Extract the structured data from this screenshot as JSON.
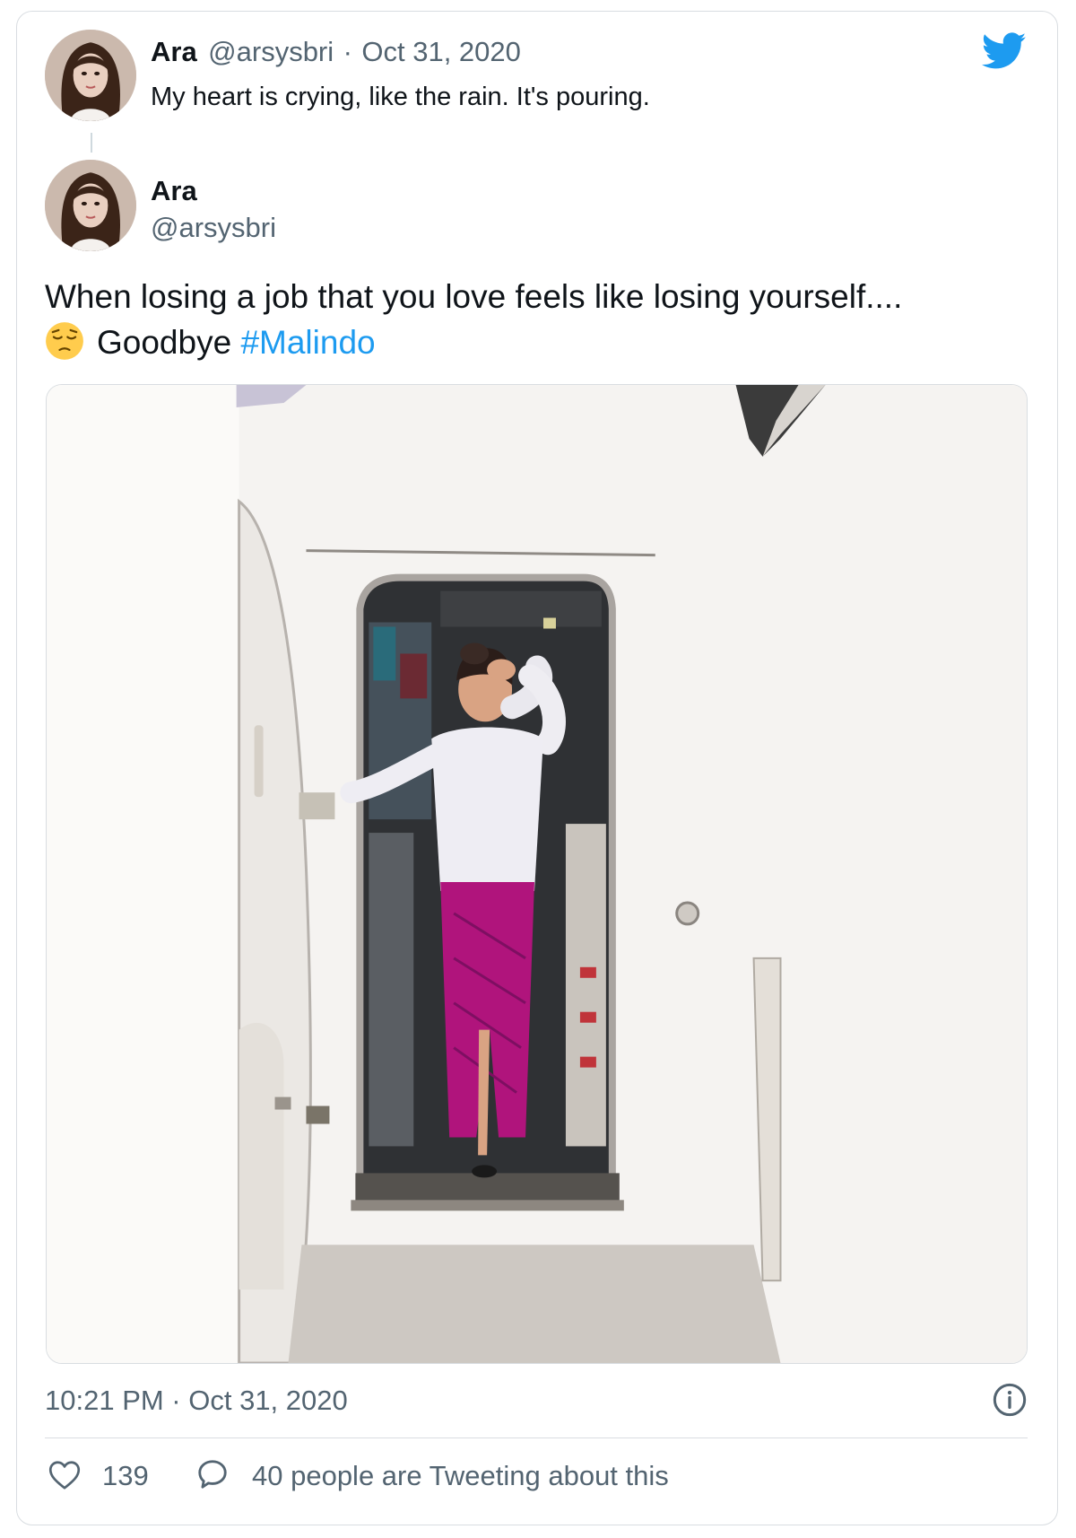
{
  "colors": {
    "accent": "#1d9bf0",
    "muted": "#536471",
    "text": "#0f1419",
    "border": "#d9dde1",
    "skirt": "#b0147c"
  },
  "icons": [
    "twitter-bird-icon",
    "pensive-face-emoji",
    "info-icon",
    "heart-icon",
    "speech-bubble-icon"
  ],
  "parent_tweet": {
    "name": "Ara",
    "handle": "@arsysbri",
    "separator": "·",
    "date": "Oct 31, 2020",
    "text": "My heart is crying, like the rain. It's pouring."
  },
  "main_tweet": {
    "name": "Ara",
    "handle": "@arsysbri",
    "text_line1": "When losing a job that you love feels like losing yourself....",
    "text_goodbye": "Goodbye",
    "hashtag": "#Malindo",
    "timestamp": "10:21 PM · Oct 31, 2020"
  },
  "engagement": {
    "likes": "139",
    "activity": "40 people are Tweeting about this"
  }
}
